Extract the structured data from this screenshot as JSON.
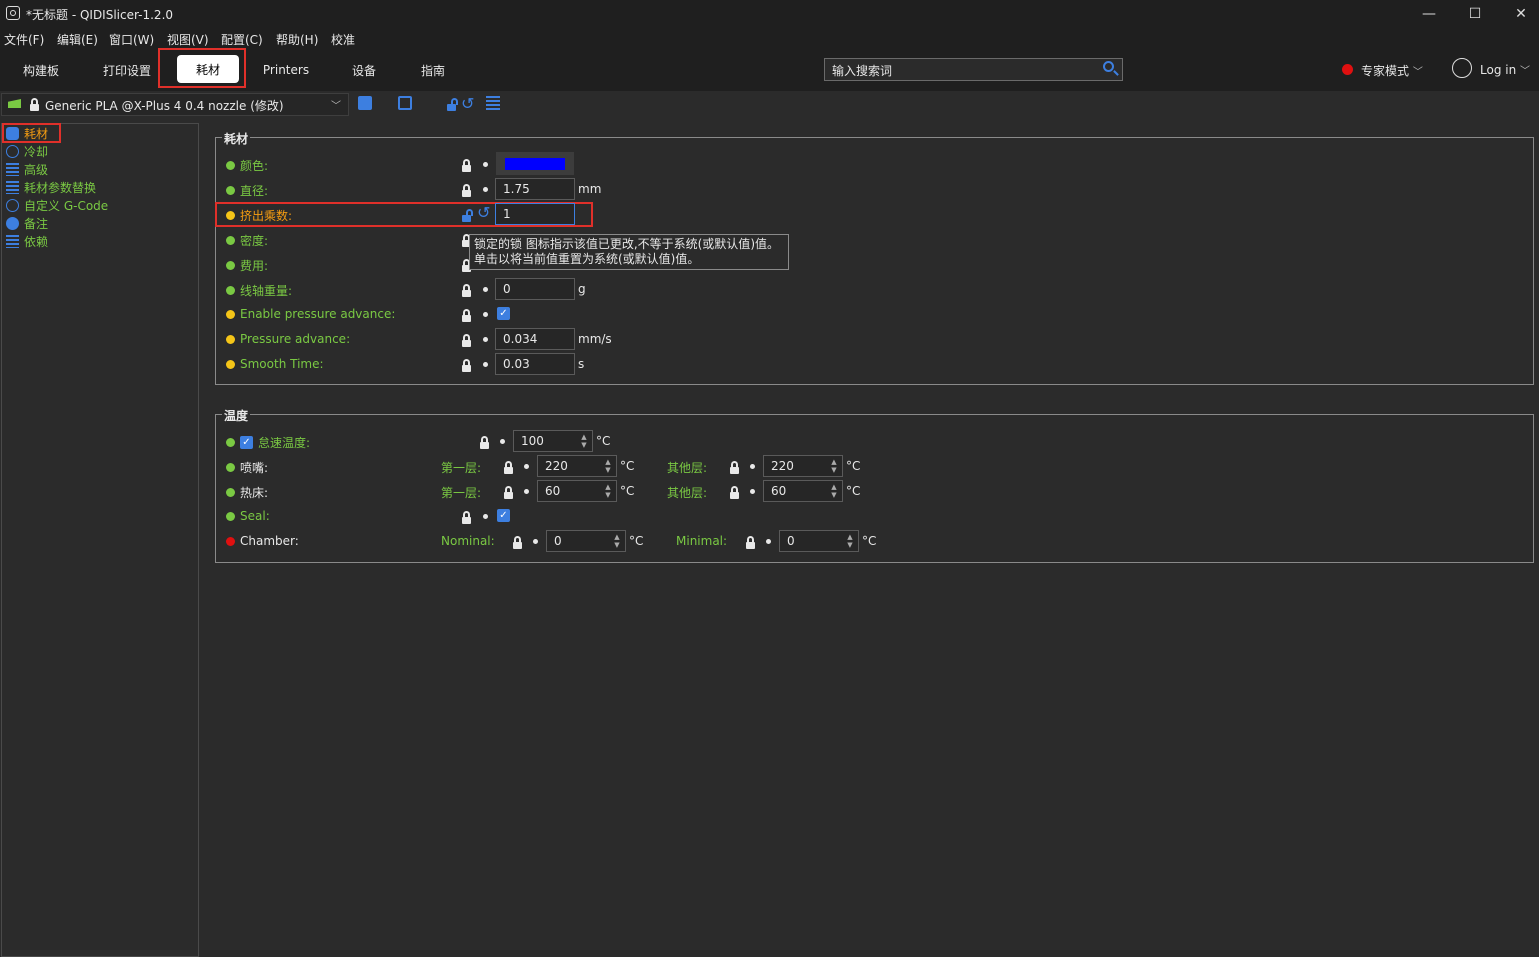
{
  "window": {
    "title": "*无标题 - QIDISlicer-1.2.0",
    "minimize": "—",
    "maximize": "☐",
    "close": "✕"
  },
  "menu": [
    "文件(F)",
    "编辑(E)",
    "窗口(W)",
    "视图(V)",
    "配置(C)",
    "帮助(H)",
    "校准"
  ],
  "tabs": [
    "构建板",
    "打印设置",
    "耗材",
    "Printers",
    "设备",
    "指南"
  ],
  "active_tab": "耗材",
  "search": {
    "value": "输入搜索词"
  },
  "mode": {
    "label": "专家模式",
    "color": "#e01010"
  },
  "login": {
    "label": "Log in"
  },
  "preset": {
    "name": "Generic PLA @X-Plus 4 0.4 nozzle (修改)"
  },
  "toolbar_icons": [
    "save-icon",
    "rename-icon",
    "unlock-icon",
    "undo-icon",
    "compare-icon"
  ],
  "sidebar": {
    "items": [
      {
        "label": "耗材",
        "icon": "speech-bubble-icon"
      },
      {
        "label": "冷却",
        "icon": "fan-icon"
      },
      {
        "label": "高级",
        "icon": "settings-icon"
      },
      {
        "label": "耗材参数替换",
        "icon": "settings-icon"
      },
      {
        "label": "自定义 G-Code",
        "icon": "gear-icon"
      },
      {
        "label": "备注",
        "icon": "speech-bubble-icon"
      },
      {
        "label": "依赖",
        "icon": "settings-icon"
      }
    ]
  },
  "filament_group": {
    "title": "耗材",
    "rows": [
      {
        "label": "颜色:",
        "value": "",
        "unit": ""
      },
      {
        "label": "直径:",
        "value": "1.75",
        "unit": "mm"
      },
      {
        "label": "挤出乘数:",
        "value": "1",
        "unit": ""
      },
      {
        "label": "密度:",
        "value": "",
        "unit": ""
      },
      {
        "label": "费用:",
        "value": "",
        "unit": ""
      },
      {
        "label": "线轴重量:",
        "value": "0",
        "unit": "g"
      },
      {
        "label": "Enable pressure advance:",
        "value": "",
        "unit": ""
      },
      {
        "label": "Pressure advance:",
        "value": "0.034",
        "unit": "mm/s"
      },
      {
        "label": "Smooth Time:",
        "value": "0.03",
        "unit": "s"
      }
    ],
    "color_value": "#0000ff",
    "pressure_advance_enabled": true
  },
  "tooltip": {
    "line1": "锁定的锁 图标指示该值已更改,不等于系统(或默认值)值。",
    "line2": "单击以将当前值重置为系统(或默认值)值。"
  },
  "temperature_group": {
    "title": "温度",
    "idle": {
      "label": "怠速温度:",
      "value": "100",
      "unit": "°C",
      "checked": true
    },
    "nozzle": {
      "label": "喷嘴:",
      "first_label": "第一层:",
      "first_value": "220",
      "other_label": "其他层:",
      "other_value": "220",
      "unit": "°C"
    },
    "bed": {
      "label": "热床:",
      "first_label": "第一层:",
      "first_value": "60",
      "other_label": "其他层:",
      "other_value": "60",
      "unit": "°C"
    },
    "seal": {
      "label": "Seal:",
      "checked": true
    },
    "chamber": {
      "label": "Chamber:",
      "nominal_label": "Nominal:",
      "nominal_value": "0",
      "minimal_label": "Minimal:",
      "minimal_value": "0",
      "unit": "°C"
    }
  }
}
